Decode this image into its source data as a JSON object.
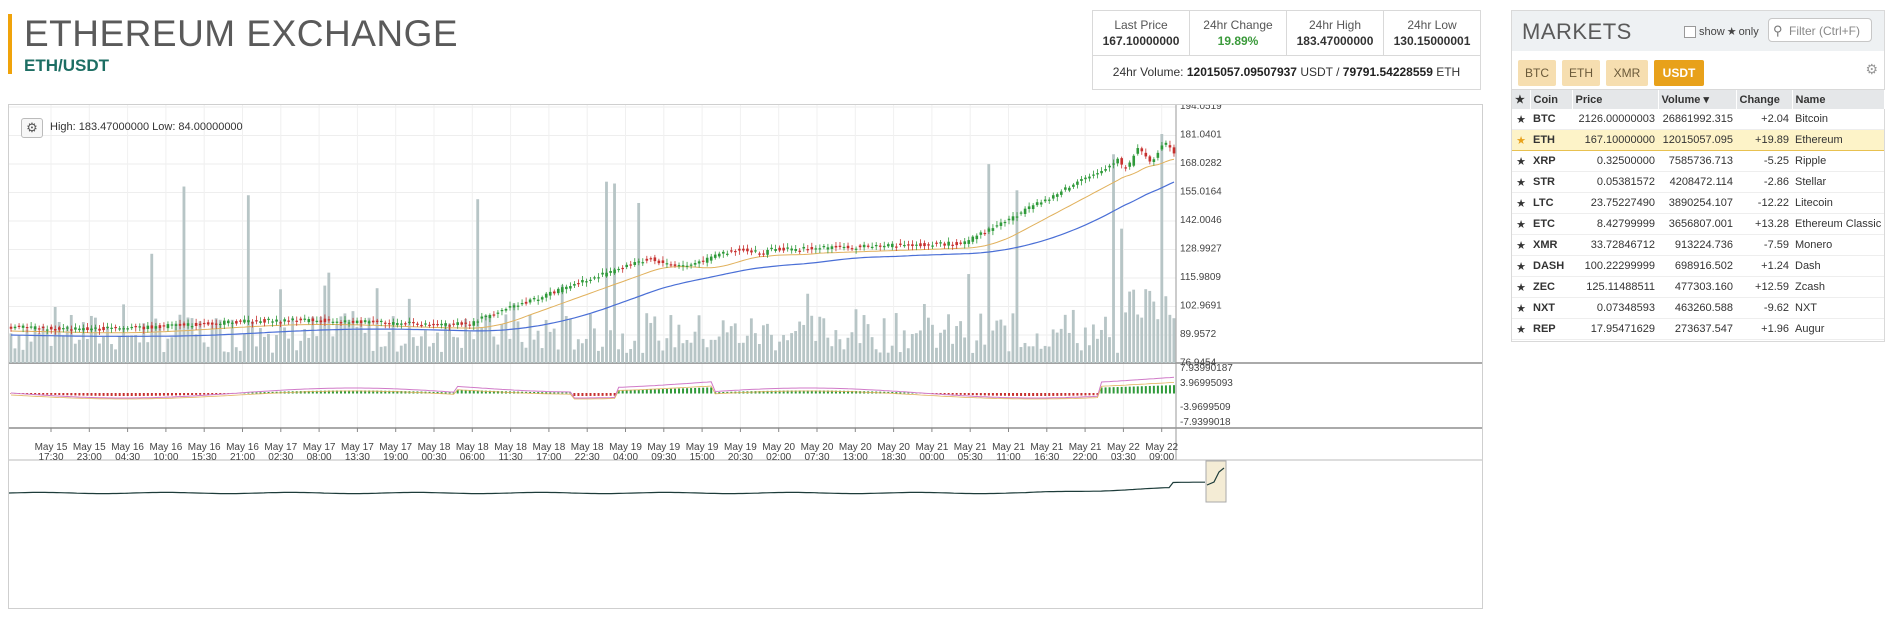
{
  "header": {
    "title": "ETHEREUM EXCHANGE",
    "pair": "ETH/USDT"
  },
  "stats": {
    "items": [
      {
        "label": "Last Price",
        "value": "167.10000000"
      },
      {
        "label": "24hr Change",
        "value": "19.89%"
      },
      {
        "label": "24hr High",
        "value": "183.47000000"
      },
      {
        "label": "24hr Low",
        "value": "130.15000001"
      }
    ],
    "volume_label": "24hr Volume:",
    "volume_usdt": "12015057.09507937",
    "volume_usdt_unit": "USDT /",
    "volume_eth": "79791.54228559",
    "volume_eth_unit": "ETH"
  },
  "chart": {
    "high_low": "High: 183.47000000  Low: 84.00000000",
    "price_axis": [
      "194.0519",
      "181.0401",
      "168.0282",
      "155.0164",
      "142.0046",
      "128.9927",
      "115.9809",
      "102.9691",
      "89.9572",
      "76.9454"
    ],
    "macd_axis": [
      "7.93990187",
      "3.96995093",
      "-3.9699509",
      "-7.9399018"
    ],
    "time_labels": [
      [
        "May 15",
        "17:30"
      ],
      [
        "May 15",
        "23:00"
      ],
      [
        "May 16",
        "04:30"
      ],
      [
        "May 16",
        "10:00"
      ],
      [
        "May 16",
        "15:30"
      ],
      [
        "May 16",
        "21:00"
      ],
      [
        "May 17",
        "02:30"
      ],
      [
        "May 17",
        "08:00"
      ],
      [
        "May 17",
        "13:30"
      ],
      [
        "May 17",
        "19:00"
      ],
      [
        "May 18",
        "00:30"
      ],
      [
        "May 18",
        "06:00"
      ],
      [
        "May 18",
        "11:30"
      ],
      [
        "May 18",
        "17:00"
      ],
      [
        "May 18",
        "22:30"
      ],
      [
        "May 19",
        "04:00"
      ],
      [
        "May 19",
        "09:30"
      ],
      [
        "May 19",
        "15:00"
      ],
      [
        "May 19",
        "20:30"
      ],
      [
        "May 20",
        "02:00"
      ],
      [
        "May 20",
        "07:30"
      ],
      [
        "May 20",
        "13:00"
      ],
      [
        "May 20",
        "18:30"
      ],
      [
        "May 21",
        "00:00"
      ],
      [
        "May 21",
        "05:30"
      ],
      [
        "May 21",
        "11:00"
      ],
      [
        "May 21",
        "16:30"
      ],
      [
        "May 21",
        "22:00"
      ],
      [
        "May 22",
        "03:30"
      ],
      [
        "May 22",
        "09:00"
      ]
    ],
    "colors": {
      "up": "#2f9a3a",
      "down": "#c7302e",
      "volume": "#b7c5c6",
      "ema_fast": "#e1b15c",
      "ema_slow": "#4a6fd6",
      "macd": "#d07ac8"
    }
  },
  "markets": {
    "title": "MARKETS",
    "show_label": "show",
    "only_label": "only",
    "filter_placeholder": "Filter (Ctrl+F)",
    "tabs": [
      "BTC",
      "ETH",
      "XMR",
      "USDT"
    ],
    "active_tab": "USDT",
    "columns": [
      "Coin",
      "Price",
      "Volume",
      "Change",
      "Name"
    ],
    "rows": [
      {
        "coin": "BTC",
        "price": "2126.00000003",
        "volume": "26861992.315",
        "change": "+2.04",
        "name": "Bitcoin"
      },
      {
        "coin": "ETH",
        "price": "167.10000000",
        "volume": "12015057.095",
        "change": "+19.89",
        "name": "Ethereum",
        "selected": true
      },
      {
        "coin": "XRP",
        "price": "0.32500000",
        "volume": "7585736.713",
        "change": "-5.25",
        "name": "Ripple"
      },
      {
        "coin": "STR",
        "price": "0.05381572",
        "volume": "4208472.114",
        "change": "-2.86",
        "name": "Stellar"
      },
      {
        "coin": "LTC",
        "price": "23.75227490",
        "volume": "3890254.107",
        "change": "-12.22",
        "name": "Litecoin"
      },
      {
        "coin": "ETC",
        "price": "8.42799999",
        "volume": "3656807.001",
        "change": "+13.28",
        "name": "Ethereum Classic"
      },
      {
        "coin": "XMR",
        "price": "33.72846712",
        "volume": "913224.736",
        "change": "-7.59",
        "name": "Monero"
      },
      {
        "coin": "DASH",
        "price": "100.22299999",
        "volume": "698916.502",
        "change": "+1.24",
        "name": "Dash"
      },
      {
        "coin": "ZEC",
        "price": "125.11488511",
        "volume": "477303.160",
        "change": "+12.59",
        "name": "Zcash"
      },
      {
        "coin": "NXT",
        "price": "0.07348593",
        "volume": "463260.588",
        "change": "-9.62",
        "name": "NXT"
      },
      {
        "coin": "REP",
        "price": "17.95471629",
        "volume": "273637.547",
        "change": "+1.96",
        "name": "Augur"
      }
    ]
  }
}
